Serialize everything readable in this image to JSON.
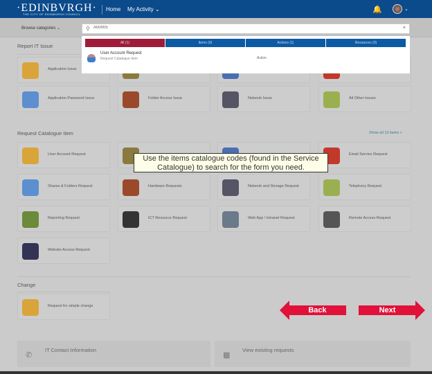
{
  "header": {
    "logo": "·EDINBVRGH·",
    "logo_sub": "THE CITY OF EDINBURGH COUNCIL",
    "nav": [
      "Home",
      "My Activity ⌄"
    ],
    "bell_icon": "bell-icon",
    "user_chevron": "⌄"
  },
  "subbar": {
    "browse": "Browse categories ⌄"
  },
  "search": {
    "value": "A00005",
    "clear": "×"
  },
  "results": {
    "tabs": [
      "All (1)",
      "Items (0)",
      "Actions (1)",
      "Resources (0)"
    ],
    "active_tab": "All (1)",
    "items": [
      {
        "title": "User Account Request",
        "subtitle": "Request Catalogue Item",
        "type": "Action"
      }
    ]
  },
  "report": {
    "title": "Report IT Issue",
    "tiles": [
      "Application Issue",
      "",
      "",
      "",
      "Application Password Issue",
      "Folder Access Issue",
      "Network Issue",
      "All Other Issues"
    ]
  },
  "catalogue": {
    "title": "Request Catalogue Item",
    "show_all": "Show all 13 items >",
    "tiles": [
      "User Account Request",
      "",
      "",
      "Email Service Request",
      "Shares & Folders Request",
      "Hardware Requests",
      "Network and Storage Request",
      "Telephony Request",
      "Reporting Request",
      "ICT Resource Request",
      "Web App / Intranet Request",
      "Remote Access Request",
      "Website Access Request"
    ]
  },
  "change": {
    "title": "Change",
    "tiles": [
      "Request for simple change"
    ]
  },
  "tooltip": "Use the items catalogue codes (found in the Service Catalogue) to search for the form you need.",
  "nav_buttons": {
    "back": "Back",
    "next": "Next",
    "color": "#e0123a"
  },
  "footer": [
    "IT Contact Information",
    "View existing requests"
  ],
  "colors": {
    "header": "#0b4a8b",
    "active_tab": "#9e1b3a",
    "tab": "#0b5aa3"
  }
}
